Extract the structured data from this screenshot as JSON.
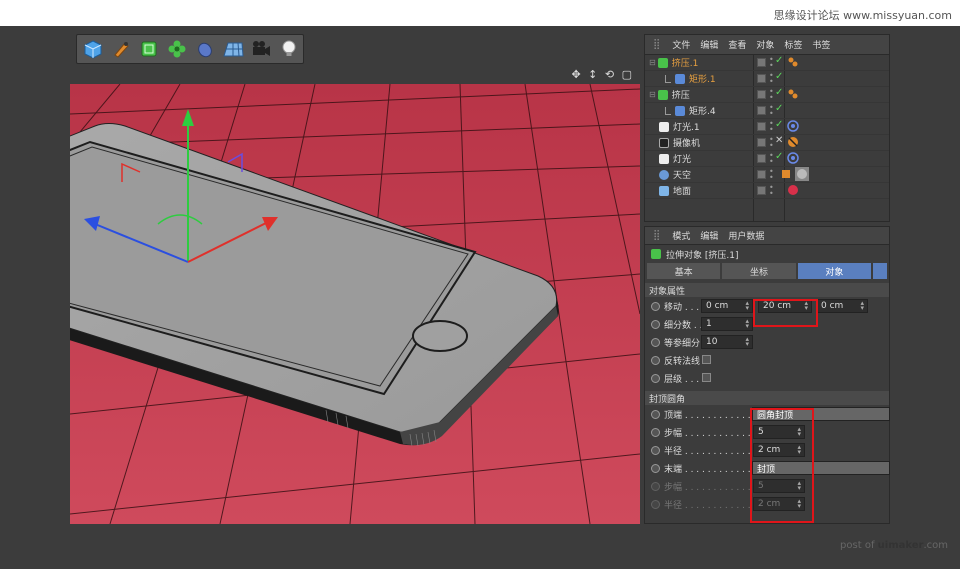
{
  "watermark_top": "思缘设计论坛  www.missyuan.com",
  "watermark_bottom": {
    "prefix": "post of ",
    "site": "uimaker",
    "suffix": ".com"
  },
  "toolbar": {
    "icons": [
      "cube-icon",
      "pen-icon",
      "subdivision-icon",
      "cloner-icon",
      "deformer-icon",
      "floor-grid-icon",
      "camera-icon",
      "light-bulb-icon"
    ]
  },
  "viewport": {
    "nav_icons": "✥ ↕ ⟲ ▢"
  },
  "object_manager": {
    "menu": [
      "文件",
      "编辑",
      "查看",
      "对象",
      "标签",
      "书签"
    ],
    "objects": [
      {
        "name": "挤压.1",
        "indent": 0,
        "selected": true,
        "icon": "extrude-icon"
      },
      {
        "name": "矩形.1",
        "indent": 1,
        "selected": true,
        "icon": "spline-icon"
      },
      {
        "name": "挤压",
        "indent": 0,
        "selected": false,
        "icon": "extrude-icon"
      },
      {
        "name": "矩形.4",
        "indent": 1,
        "selected": false,
        "icon": "spline-icon"
      },
      {
        "name": "灯光.1",
        "indent": 0,
        "selected": false,
        "icon": "light-icon"
      },
      {
        "name": "摄像机",
        "indent": 0,
        "selected": false,
        "icon": "camera-icon"
      },
      {
        "name": "灯光",
        "indent": 0,
        "selected": false,
        "icon": "light-icon"
      },
      {
        "name": "天空",
        "indent": 0,
        "selected": false,
        "icon": "sky-icon"
      },
      {
        "name": "地面",
        "indent": 0,
        "selected": false,
        "icon": "floor-icon"
      }
    ]
  },
  "attribute_manager": {
    "menu": [
      "模式",
      "编辑",
      "用户数据"
    ],
    "title": "拉伸对象 [挤压.1]",
    "tabs": [
      "基本",
      "坐标",
      "对象"
    ],
    "active_tab": "对象",
    "section_object": "对象属性",
    "move_label": "移动 . . .",
    "move_values": [
      "0 cm",
      "20 cm",
      "0 cm"
    ],
    "subdiv_label": "细分数 . .",
    "subdiv_value": "1",
    "iso_label": "等参细分",
    "iso_value": "10",
    "flip_label": "反转法线",
    "hier_label": "层级 . . .",
    "section_caps": "封顶圆角",
    "top_label": "顶端 . . . . . . . . . . . . .",
    "top_value": "圆角封顶",
    "steps_label": "步幅 . . . . . . . . . . . . .",
    "steps_value": "5",
    "radius_label": "半径 . . . . . . . . . . . . .",
    "radius_value": "2 cm",
    "end_label": "末端 . . . . . . . . . . . . .",
    "end_value": "封顶",
    "steps2_label": "步幅 . . . . . . . . . . . . .",
    "steps2_value": "5",
    "radius2_label": "半径 . . . . . . . . . . . . .",
    "radius2_value": "2 cm"
  },
  "colors": {
    "floor": "#c8475a",
    "app_bg": "#3c3c3c",
    "highlight": "#e0151a",
    "tab_active": "#5a7fbf"
  }
}
